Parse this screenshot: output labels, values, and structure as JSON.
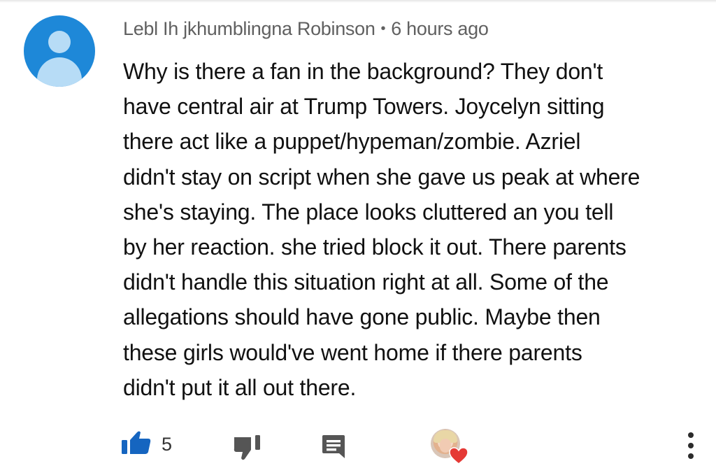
{
  "comment": {
    "author": "Lebl Ih jkhumblingna Robinson",
    "separator": "•",
    "timestamp": "6 hours ago",
    "lines": [
      "Why is there a fan in the background? They don't",
      "have central air at Trump Towers. Joycelyn sitting",
      "there act like a puppet/hypeman/zombie. Azriel",
      "didn't stay on script when she gave us peak at where",
      "she's staying. The place looks cluttered an you tell",
      "by her reaction. she tried block it out. There parents",
      "didn't handle this situation right at all. Some of the",
      "allegations should have gone public. Maybe then",
      "these girls would've went home if there parents",
      "didn't put it all out there."
    ]
  },
  "actions": {
    "like_count": "5",
    "like_icon": "thumbs-up-icon",
    "dislike_icon": "thumbs-down-icon",
    "reply_icon": "comment-reply-icon",
    "creator_heart_icon": "creator-heart-icon",
    "more_icon": "more-vertical-icon"
  },
  "colors": {
    "avatar_bg": "#1e88d8",
    "avatar_fg": "#b7dcf6",
    "like_active": "#1565c0",
    "icon_gray": "#555555",
    "heart": "#e53935",
    "meta_text": "#606060",
    "body_text": "#111111"
  }
}
